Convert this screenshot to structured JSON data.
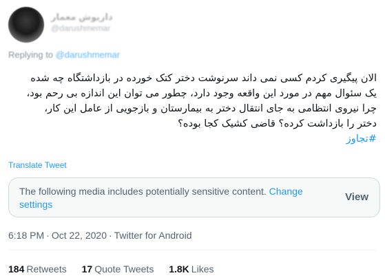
{
  "author": {
    "display_name": "داریوش معمار",
    "handle": "@darushmemar"
  },
  "replying": {
    "prefix": "Replying to",
    "mention": "@darushmemar"
  },
  "tweet": {
    "lines": [
      "الان پیگیری کردم کسی نمی داند سرنوشت دختر کتک خورده در بازداشتگاه چه شده",
      "یک سئوال مهم در مورد این واقعه وجود دارد، چطور می توان این اندازه بی رحم بود،",
      "چرا  نیروی انتظامی به جای انتقال دختر به بیمارستان و بازجویی از عامل این کار،",
      "دختر را بازداشت کرده؟ قاضی کشیک کجا بوده؟"
    ],
    "hashtag": "#تجاوز"
  },
  "translate_label": "Translate Tweet",
  "sensitive": {
    "message": "The following media includes potentially sensitive content.",
    "change_label": "Change settings",
    "view_label": "View"
  },
  "meta": {
    "time": "6:18 PM",
    "date": "Oct 22, 2020",
    "source": "Twitter for Android",
    "separator": "·"
  },
  "stats": {
    "retweets_count": "184",
    "retweets_label": "Retweets",
    "quotes_count": "17",
    "quotes_label": "Quote Tweets",
    "likes_count": "1.8K",
    "likes_label": "Likes"
  },
  "colors": {
    "accent": "#1d9bf0",
    "secondary_text": "#536471",
    "primary_text": "#0f1419",
    "notice_bg": "#f7f9f9",
    "border": "#cfd9de"
  }
}
